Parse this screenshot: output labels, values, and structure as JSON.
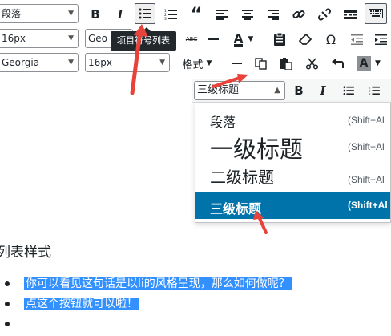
{
  "toolbar_row1": {
    "format_select": "段落",
    "bold_label": "B",
    "italic_label": "I",
    "active_tool": "bulleted-list"
  },
  "toolbar_row2": {
    "font_size_select": "16px",
    "font_family_select": "Geo",
    "text_color_label": "A",
    "strike_label": "ABC",
    "omega_label": "Ω"
  },
  "toolbar_row3": {
    "font_family_select": "Georgia",
    "font_size_select": "16px",
    "format_menu_label": "格式",
    "bg_color_label": "A"
  },
  "tooltip": "项目符号列表",
  "inner_toolbar": {
    "heading_select": "三级标题",
    "bold_label": "B",
    "italic_label": "I"
  },
  "format_menu": {
    "items": [
      {
        "label": "段落",
        "shortcut": "(Shift+Al"
      },
      {
        "label": "一级标题",
        "shortcut": "(Shift+Al"
      },
      {
        "label": "二级标题",
        "shortcut": "(Shift+Al"
      },
      {
        "label": "三级标题",
        "shortcut": "(Shift+Al",
        "selected": true
      }
    ]
  },
  "content": {
    "heading": "列表样式",
    "list": [
      "你可以看见这句话是以li的风格呈现，那么如何做呢？",
      "点这个按钮就可以啦！",
      ""
    ]
  },
  "colors": {
    "accent": "#0073aa",
    "selection": "#3390ff",
    "annotation_arrow": "#e8433b",
    "tooltip_bg": "#23282d"
  }
}
